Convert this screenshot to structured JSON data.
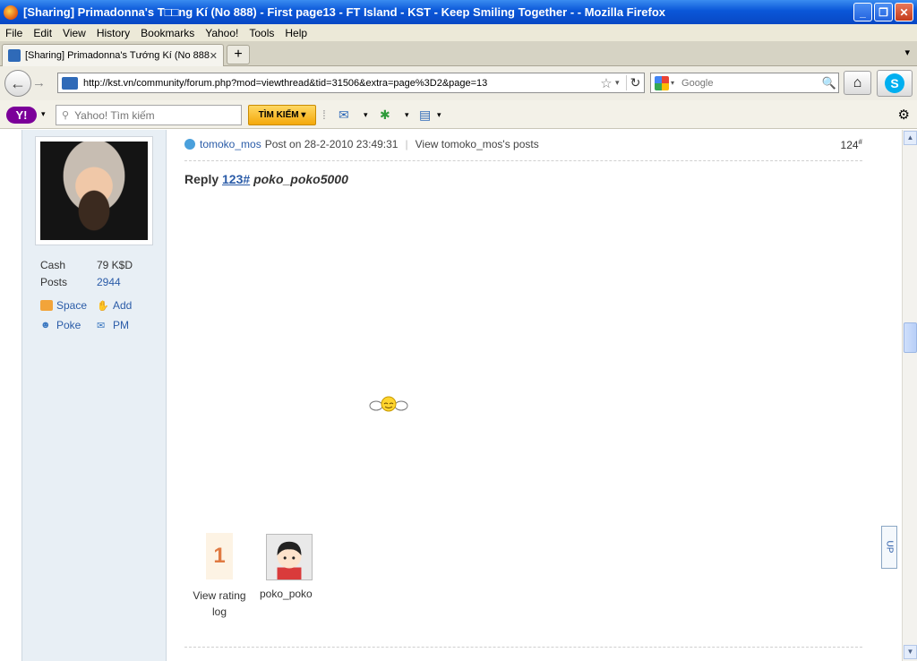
{
  "window": {
    "title": "[Sharing] Primadonna's T□□ng Kí (No 888) - First page13 - FT Island - KST - Keep Smiling Together - - Mozilla Firefox"
  },
  "menu": {
    "file": "File",
    "edit": "Edit",
    "view": "View",
    "history": "History",
    "bookmarks": "Bookmarks",
    "yahoo": "Yahoo!",
    "tools": "Tools",
    "help": "Help"
  },
  "tab": {
    "label": "[Sharing] Primadonna's Tướng Kí (No 888) - ...",
    "new_tab": "+"
  },
  "nav": {
    "url": "http://kst.vn/community/forum.php?mod=viewthread&tid=31506&extra=page%3D2&page=13",
    "search_placeholder": "Google"
  },
  "yahoo_toolbar": {
    "logo": "Y!",
    "search_placeholder": "Yahoo! Tìm kiếm",
    "search_button": "TÌM KIẾM ▾"
  },
  "sidebar": {
    "cash_label": "Cash",
    "cash_value": "79 K$D",
    "posts_label": "Posts",
    "posts_value": "2944",
    "space": "Space",
    "add": "Add",
    "poke": "Poke",
    "pm": "PM"
  },
  "post": {
    "author": "tomoko_mos",
    "posted_on": "Post on 28-2-2010 23:49:31",
    "separator": "|",
    "view_posts": "View tomoko_mos's posts",
    "number": "124",
    "number_mark": "#",
    "reply_word": "Reply",
    "reply_link": "123#",
    "reply_user": "poko_poko5000"
  },
  "rating": {
    "count": "1",
    "view_log": "View rating log",
    "rater_name": "poko_poko"
  },
  "updown": {
    "label": "UP"
  },
  "colors": {
    "titlebar": "#0a56d8",
    "link": "#2b5ca8",
    "sidebar_bg": "#e8eff5",
    "rating_number": "#e07a42"
  }
}
